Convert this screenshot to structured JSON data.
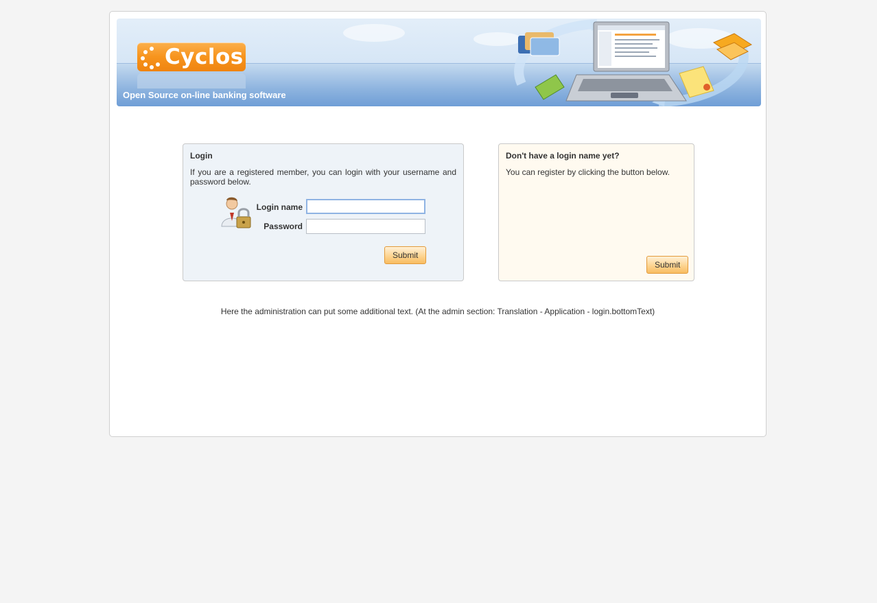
{
  "banner": {
    "logo_text": "Cyclos",
    "tagline": "Open Source on-line banking software"
  },
  "login_panel": {
    "title": "Login",
    "description": "If you are a registered member, you can login with your username and password below.",
    "login_name_label": "Login name",
    "login_name_value": "",
    "password_label": "Password",
    "password_value": "",
    "submit_label": "Submit"
  },
  "register_panel": {
    "title": "Don't have a login name yet?",
    "description": "You can register by clicking the button below.",
    "submit_label": "Submit"
  },
  "bottom_text": "Here the administration can put some additional text. (At the admin section: Translation - Application - login.bottomText)",
  "colors": {
    "accent_orange": "#f7941d",
    "banner_blue": "#6f9ed6",
    "login_panel_bg": "#eef3f8",
    "register_panel_bg": "#fffaf0"
  },
  "icons": {
    "logo_mark": "dotted-circle-logo",
    "user_lock": "user-lock-icon",
    "banner_art": "laptop-cards-illustration"
  }
}
